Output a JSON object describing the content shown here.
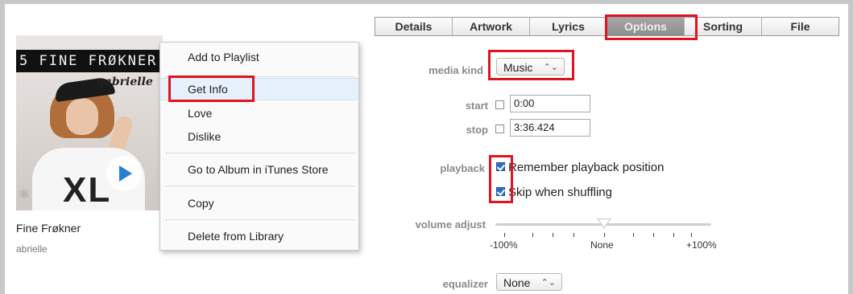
{
  "album": {
    "banner": "5 FINE FRØKNER",
    "artist_script": "gabrielle",
    "shirt_text": "XL",
    "play_icon": "play-icon"
  },
  "song": {
    "title": "Fine Frøkner",
    "artist": "abrielle"
  },
  "context_menu": {
    "items": [
      "Add to Playlist",
      "Get Info",
      "Love",
      "Dislike",
      "Go to Album in iTunes Store",
      "Copy",
      "Delete from Library"
    ],
    "highlighted": "Get Info"
  },
  "tabs": [
    "Details",
    "Artwork",
    "Lyrics",
    "Options",
    "Sorting",
    "File"
  ],
  "active_tab": "Options",
  "options": {
    "media_kind_label": "media kind",
    "media_kind_value": "Music",
    "start_label": "start",
    "start_value": "0:00",
    "start_checked": false,
    "stop_label": "stop",
    "stop_value": "3:36.424",
    "stop_checked": false,
    "playback_label": "playback",
    "remember_label": "Remember playback position",
    "remember_checked": true,
    "skip_label": "Skip when shuffling",
    "skip_checked": true,
    "volume_label": "volume adjust",
    "volume_ticks": [
      "-100%",
      "None",
      "+100%"
    ],
    "volume_level": "None",
    "equalizer_label": "equalizer",
    "equalizer_value": "None"
  },
  "colors": {
    "highlight_box": "#e0141e",
    "menu_hover": "#e7f1fc",
    "active_tab": "#999999",
    "checkbox": "#2f6fc4"
  }
}
